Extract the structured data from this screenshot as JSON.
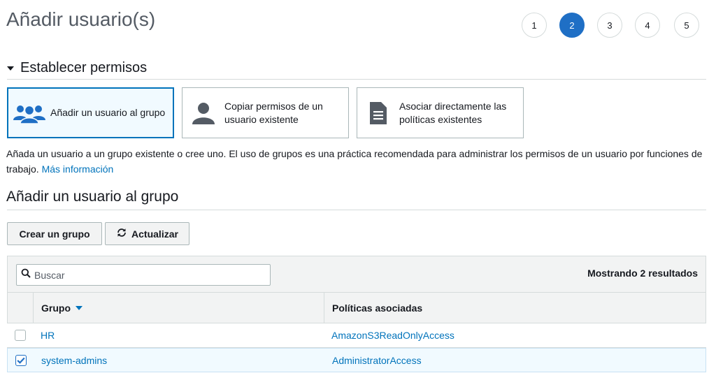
{
  "page_title": "Añadir usuario(s)",
  "steps": [
    "1",
    "2",
    "3",
    "4",
    "5"
  ],
  "active_step": "2",
  "section": {
    "label": "Establecer permisos"
  },
  "options": [
    {
      "label": "Añadir un usuario al grupo",
      "icon": "users-group-icon",
      "selected": true
    },
    {
      "label": "Copiar permisos de un usuario existente",
      "icon": "user-icon",
      "selected": false
    },
    {
      "label": "Asociar directamente las políticas existentes",
      "icon": "document-icon",
      "selected": false
    }
  ],
  "description": {
    "text": "Añada un usuario a un grupo existente o cree uno. El uso de grupos es una práctica recomendada para administrar los permisos de un usuario por funciones de trabajo.",
    "link": "Más información"
  },
  "group_section": {
    "title": "Añadir un usuario al grupo",
    "create_button": "Crear un grupo",
    "refresh_button": "Actualizar"
  },
  "table": {
    "search_placeholder": "Buscar",
    "results_text": "Mostrando 2 resultados",
    "columns": [
      "Grupo",
      "Políticas asociadas"
    ],
    "rows": [
      {
        "group": "HR",
        "policy": "AmazonS3ReadOnlyAccess",
        "checked": false
      },
      {
        "group": "system-admins",
        "policy": "AdministratorAccess",
        "checked": true
      }
    ]
  },
  "colors": {
    "accent": "#1f6fc5",
    "link": "#0073bb",
    "selected_bg": "#f1faff"
  }
}
